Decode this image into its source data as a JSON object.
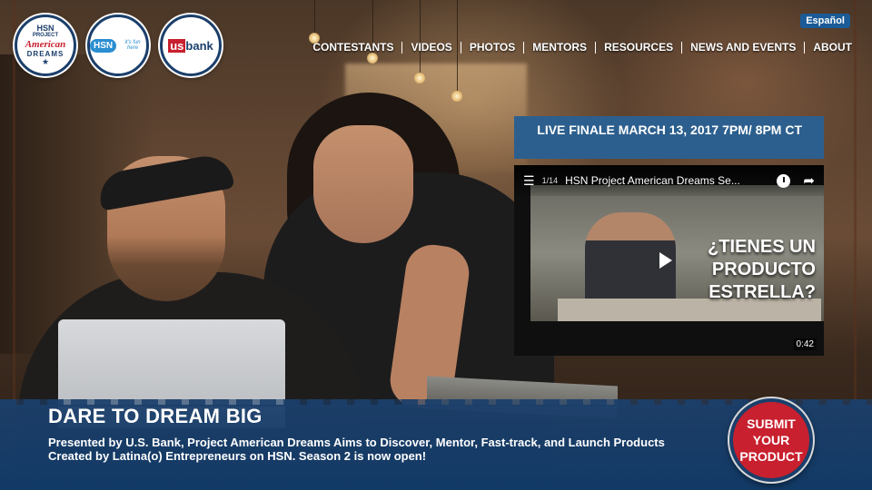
{
  "header": {
    "logos": [
      {
        "name": "hsn-project-american-dreams-logo",
        "top": "HSN",
        "top2": "PROJECT",
        "mid": "American",
        "bot": "DREAMS"
      },
      {
        "name": "hsn-logo",
        "badge": "HSN",
        "tag": "it's fun here"
      },
      {
        "name": "us-bank-logo",
        "us": "us",
        "bank": "bank"
      }
    ],
    "language_button": "Español",
    "nav": [
      "CONTESTANTS",
      "VIDEOS",
      "PHOTOS",
      "MENTORS",
      "RESOURCES",
      "NEWS AND EVENTS",
      "ABOUT"
    ]
  },
  "finale": {
    "text": "LIVE FINALE MARCH 13, 2017 7PM/ 8PM CT"
  },
  "video": {
    "playlist_icon": "playlist-icon",
    "playlist_count": "1/14",
    "title": "HSN Project American Dreams Se...",
    "overlay_text": "¿TIENES UN PRODUCTO ESTRELLA?",
    "duration": "0:42"
  },
  "hero": {
    "title": "DARE TO DREAM BIG",
    "subtitle": "Presented by U.S. Bank, Project American Dreams Aims to Discover, Mentor, Fast-track, and Launch Products Created by Latina(o) Entrepreneurs on HSN. Season 2 is now open!",
    "cta": "SUBMIT YOUR PRODUCT"
  },
  "colors": {
    "navy": "#1b3f6b",
    "banner_blue": "#2c5f8e",
    "red": "#c8202e"
  }
}
